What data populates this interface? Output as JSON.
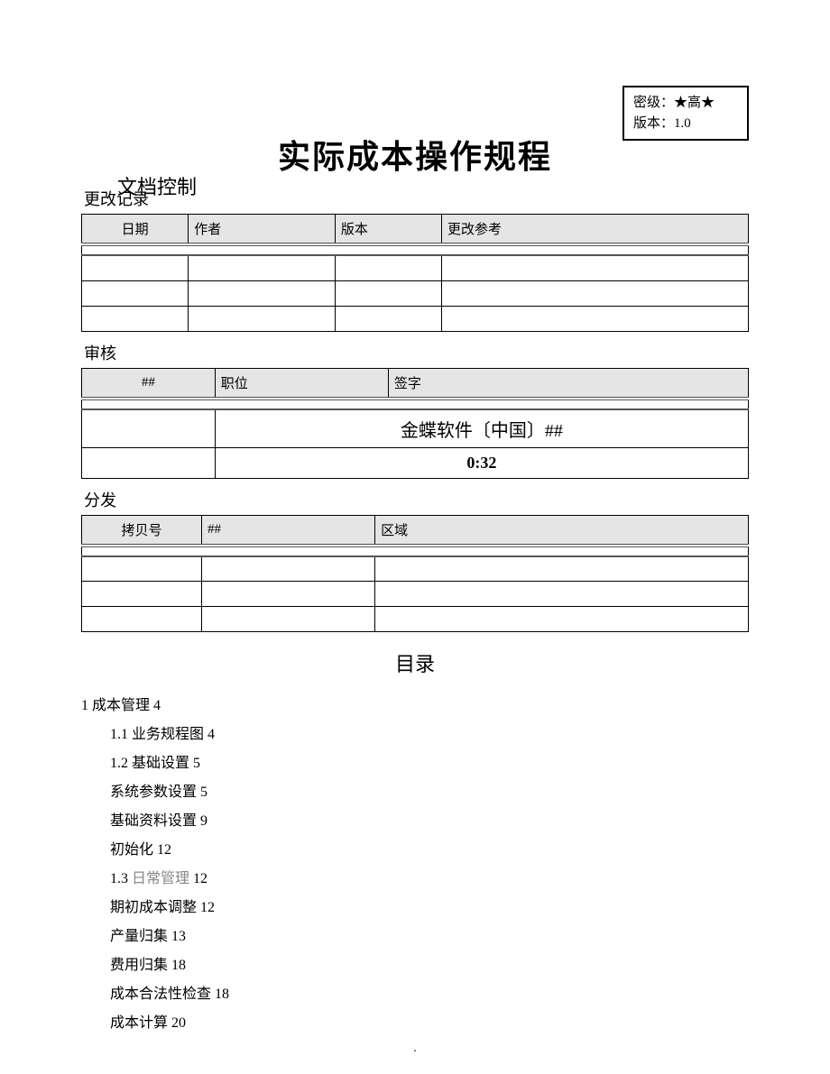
{
  "info_box": {
    "level_label": "密级：",
    "level_value": "★高★",
    "version_label": "版本：",
    "version_value": "1.0"
  },
  "doc_control_label": "文档控制",
  "main_title": "实际成本操作规程",
  "sections": {
    "change_log": {
      "label": "更改记录",
      "headers": [
        "日期",
        "作者",
        "版本",
        "更改参考"
      ],
      "rows": [
        [
          "",
          "",
          "",
          ""
        ],
        [
          "",
          "",
          "",
          ""
        ],
        [
          "",
          "",
          "",
          ""
        ]
      ]
    },
    "review": {
      "label": "审核",
      "headers": [
        "##",
        "职位",
        "签字"
      ],
      "company_text": "金蝶软件〔中国〕##",
      "time_text": "0:32"
    },
    "distribute": {
      "label": "分发",
      "headers": [
        "拷贝号",
        "##",
        "区域"
      ],
      "rows": [
        [
          "",
          "",
          ""
        ],
        [
          "",
          "",
          ""
        ],
        [
          "",
          "",
          ""
        ]
      ]
    }
  },
  "toc_title": "目录",
  "toc": [
    {
      "level": 1,
      "text": "1 成本管理 4",
      "gray": false
    },
    {
      "level": 2,
      "text": "1.1 业务规程图 4",
      "gray": false
    },
    {
      "level": 2,
      "text": "1.2 基础设置 5",
      "gray": false
    },
    {
      "level": 2,
      "text": "系统参数设置 5",
      "gray": false
    },
    {
      "level": 2,
      "text": "基础资料设置 9",
      "gray": false
    },
    {
      "level": 2,
      "text": "初始化 12",
      "gray": false
    },
    {
      "level": 2,
      "text": "1.3 日常管理 12",
      "gray": true
    },
    {
      "level": 2,
      "text": "期初成本调整 12",
      "gray": false
    },
    {
      "level": 2,
      "text": "产量归集 13",
      "gray": false
    },
    {
      "level": 2,
      "text": "费用归集 18",
      "gray": false
    },
    {
      "level": 2,
      "text": "成本合法性检查 18",
      "gray": false
    },
    {
      "level": 2,
      "text": "成本计算 20",
      "gray": false
    }
  ],
  "footer": "."
}
